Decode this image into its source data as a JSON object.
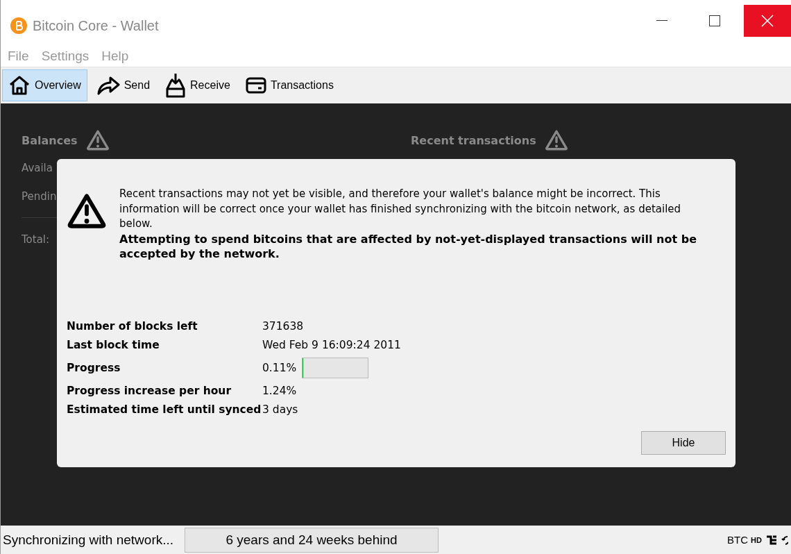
{
  "window": {
    "title": "Bitcoin Core - Wallet"
  },
  "menu": [
    "File",
    "Settings",
    "Help"
  ],
  "toolbar": [
    {
      "label": "Overview",
      "kind": "house",
      "selected": true
    },
    {
      "label": "Send",
      "kind": "send",
      "selected": false
    },
    {
      "label": "Receive",
      "kind": "receive",
      "selected": false
    },
    {
      "label": "Transactions",
      "kind": "card",
      "selected": false
    }
  ],
  "overview": {
    "balances_title": "Balances",
    "recent_title": "Recent transactions",
    "labels": [
      "Availa",
      "Pendin",
      "Total:"
    ]
  },
  "sync_modal": {
    "message": "Recent transactions may not yet be visible, and therefore your wallet's balance might be incorrect. This information will be correct once your wallet has finished synchronizing with the bitcoin network, as detailed below.",
    "warning": "Attempting to spend bitcoins that are affected by not-yet-displayed transactions will not be accepted by the network.",
    "rows": [
      {
        "label": "Number of blocks left",
        "value": "371638"
      },
      {
        "label": "Last block time",
        "value": "Wed Feb 9 16:09:24 2011"
      },
      {
        "label": "Progress",
        "value": "0.11%",
        "level": 0.0011
      },
      {
        "label": "Progress increase per hour",
        "value": "1.24%"
      },
      {
        "label": "Estimated time left until synced",
        "value": "3 days"
      }
    ],
    "button": "Hide"
  },
  "status_bar": {
    "status": "Synchronizing with network...",
    "behind": "6 years and 24 weeks behind",
    "unit": "BTC",
    "hd": "HD"
  }
}
